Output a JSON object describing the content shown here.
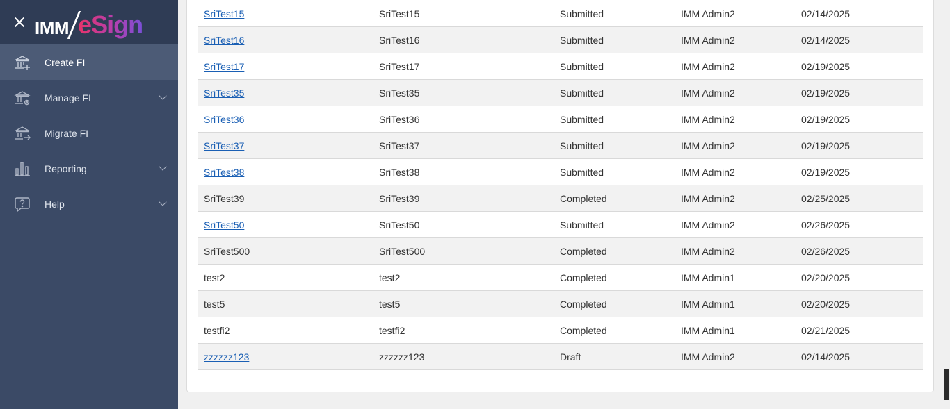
{
  "logo": {
    "imm": "IMM",
    "esign": "eSign"
  },
  "nav": {
    "items": [
      {
        "label": "Create FI",
        "active": true,
        "icon": "bank-add-icon"
      },
      {
        "label": "Manage FI",
        "expandable": true,
        "icon": "bank-gear-icon"
      },
      {
        "label": "Migrate FI",
        "icon": "bank-arrow-icon"
      },
      {
        "label": "Reporting",
        "expandable": true,
        "icon": "bar-chart-icon"
      },
      {
        "label": "Help",
        "expandable": true,
        "icon": "help-bubble-icon"
      }
    ]
  },
  "table": {
    "rows": [
      {
        "name": "SriTest15",
        "link": true,
        "title": "SriTest15",
        "status": "Submitted",
        "user": "IMM Admin2",
        "date": "02/14/2025"
      },
      {
        "name": "SriTest16",
        "link": true,
        "title": "SriTest16",
        "status": "Submitted",
        "user": "IMM Admin2",
        "date": "02/14/2025"
      },
      {
        "name": "SriTest17",
        "link": true,
        "title": "SriTest17",
        "status": "Submitted",
        "user": "IMM Admin2",
        "date": "02/19/2025"
      },
      {
        "name": "SriTest35",
        "link": true,
        "title": "SriTest35",
        "status": "Submitted",
        "user": "IMM Admin2",
        "date": "02/19/2025"
      },
      {
        "name": "SriTest36",
        "link": true,
        "title": "SriTest36",
        "status": "Submitted",
        "user": "IMM Admin2",
        "date": "02/19/2025"
      },
      {
        "name": "SriTest37",
        "link": true,
        "title": "SriTest37",
        "status": "Submitted",
        "user": "IMM Admin2",
        "date": "02/19/2025"
      },
      {
        "name": "SriTest38",
        "link": true,
        "title": "SriTest38",
        "status": "Submitted",
        "user": "IMM Admin2",
        "date": "02/19/2025"
      },
      {
        "name": "SriTest39",
        "link": false,
        "title": "SriTest39",
        "status": "Completed",
        "user": "IMM Admin2",
        "date": "02/25/2025"
      },
      {
        "name": "SriTest50",
        "link": true,
        "title": "SriTest50",
        "status": "Submitted",
        "user": "IMM Admin2",
        "date": "02/26/2025"
      },
      {
        "name": "SriTest500",
        "link": false,
        "title": "SriTest500",
        "status": "Completed",
        "user": "IMM Admin2",
        "date": "02/26/2025"
      },
      {
        "name": "test2",
        "link": false,
        "title": "test2",
        "status": "Completed",
        "user": "IMM Admin1",
        "date": "02/20/2025"
      },
      {
        "name": "test5",
        "link": false,
        "title": "test5",
        "status": "Completed",
        "user": "IMM Admin1",
        "date": "02/20/2025"
      },
      {
        "name": "testfi2",
        "link": false,
        "title": "testfi2",
        "status": "Completed",
        "user": "IMM Admin1",
        "date": "02/21/2025"
      },
      {
        "name": "zzzzzz123",
        "link": true,
        "title": "zzzzzz123",
        "status": "Draft",
        "user": "IMM Admin2",
        "date": "02/14/2025"
      }
    ]
  },
  "colors": {
    "sidebar": "#3b4a66",
    "sidebar_header": "#2f3c55",
    "active_nav": "#4c5b76",
    "link": "#1a5fb4",
    "row_alt": "#f2f2f2"
  }
}
